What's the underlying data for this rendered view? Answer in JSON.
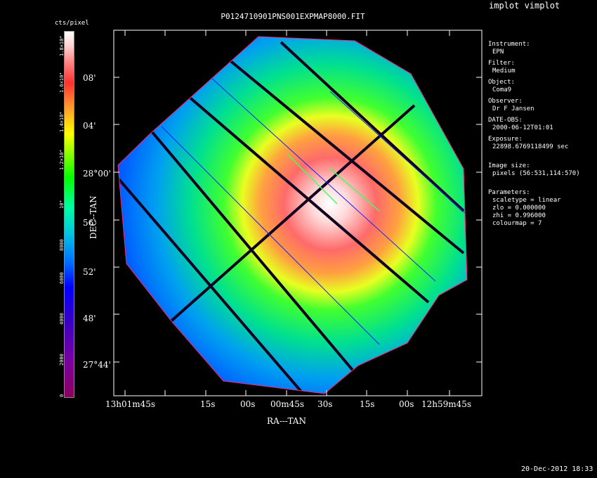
{
  "app_title": "implot vimplot",
  "plot_title": "P0124710901PNS001EXPMAP8000.FIT",
  "colorbar": {
    "label": "cts/pixel",
    "ticks": [
      "0",
      "2000",
      "4000",
      "6000",
      "8000",
      "10⁴",
      "1.2×10⁴",
      "1.4×10⁴",
      "1.6×10⁴",
      "1.8×10⁴"
    ]
  },
  "axes": {
    "xlabel": "RA---TAN",
    "ylabel": "DEC--TAN",
    "x_ticks": [
      "13h01m45s",
      "15s",
      "00s",
      "00m45s",
      "30s",
      "15s",
      "00s",
      "12h59m45s"
    ],
    "y_ticks": [
      "08'",
      "04'",
      "28°00'",
      "56'",
      "52'",
      "48'",
      "27°44'"
    ]
  },
  "info": {
    "instrument_label": "Instrument:",
    "instrument": "EPN",
    "filter_label": "Filter:",
    "filter": "Medium",
    "object_label": "Object:",
    "object": "Coma9",
    "observer_label": "Observer:",
    "observer": "Dr F Jansen",
    "date_label": "DATE-OBS:",
    "date": "2000-06-12T01:01",
    "exposure_label": "Exposure:",
    "exposure": "22898.6769118499 sec",
    "imagesize_label": "Image size:",
    "imagesize": "pixels (56:531,114:570)",
    "params_label": "Parameters:",
    "scaletype": "scaletype = linear",
    "zlo": "zlo = 0.000000",
    "zhi": "zhi = 0.996000",
    "colourmap": "colourmap =   7"
  },
  "timestamp": "20-Dec-2012 18:33",
  "colors": {
    "background": "#000000",
    "frame": "#ffffff",
    "center": "#ffffff",
    "edge": "#0055ff"
  }
}
